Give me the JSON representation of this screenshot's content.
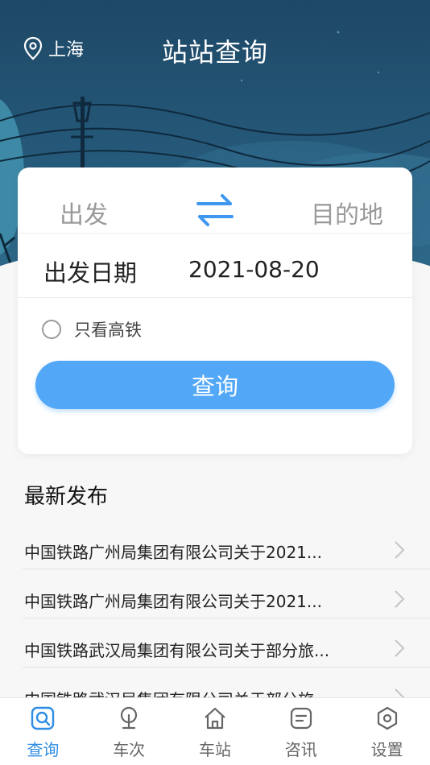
{
  "header": {
    "city": "上海",
    "title": "站站查询"
  },
  "search_card": {
    "from_placeholder": "出发",
    "to_placeholder": "目的地",
    "date_label": "出发日期",
    "date_value": "2021-08-20",
    "high_speed_only_label": "只看高铁",
    "high_speed_only_checked": false,
    "search_button_label": "查询"
  },
  "news": {
    "title": "最新发布",
    "items": [
      {
        "text": "中国铁路广州局集团有限公司关于2021..."
      },
      {
        "text": "中国铁路广州局集团有限公司关于2021..."
      },
      {
        "text": "中国铁路武汉局集团有限公司关于部分旅..."
      },
      {
        "text": "中国铁路武汉局集团有限公司关于部分旅..."
      }
    ]
  },
  "tabbar": {
    "items": [
      {
        "label": "查询",
        "icon": "search-icon",
        "active": true
      },
      {
        "label": "车次",
        "icon": "train-icon",
        "active": false
      },
      {
        "label": "车站",
        "icon": "station-icon",
        "active": false
      },
      {
        "label": "咨讯",
        "icon": "news-icon",
        "active": false
      },
      {
        "label": "设置",
        "icon": "settings-icon",
        "active": false
      }
    ]
  },
  "colors": {
    "accent": "#52a7f7",
    "active_tab": "#2f8de4",
    "header_bg": "#245676"
  }
}
